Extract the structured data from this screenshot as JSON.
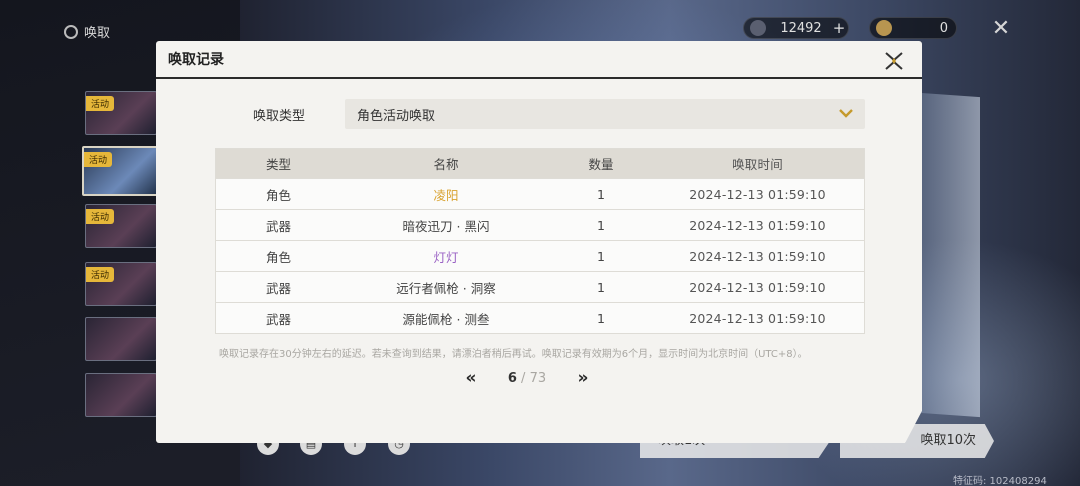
{
  "background": {
    "screen_title": "唤取",
    "banner_tag": "活动",
    "currency_star": "12492",
    "currency_coin": "0",
    "add_symbol": "+",
    "pull_ten_label": "唤取10次",
    "pull_one_label": "唤取1次",
    "uid": "特征码: 102408294"
  },
  "modal": {
    "title": "唤取记录",
    "type_label": "唤取类型",
    "type_value": "角色活动唤取",
    "columns": [
      "类型",
      "名称",
      "数量",
      "唤取时间"
    ],
    "rows": [
      {
        "type": "角色",
        "name": "凌阳",
        "qty": "1",
        "time": "2024-12-13 01:59:10",
        "name_color": "#d9a22e"
      },
      {
        "type": "武器",
        "name": "暗夜迅刀 · 黑闪",
        "qty": "1",
        "time": "2024-12-13 01:59:10",
        "name_color": "#444444"
      },
      {
        "type": "角色",
        "name": "灯灯",
        "qty": "1",
        "time": "2024-12-13 01:59:10",
        "name_color": "#9a62c4"
      },
      {
        "type": "武器",
        "name": "远行者佩枪 · 洞察",
        "qty": "1",
        "time": "2024-12-13 01:59:10",
        "name_color": "#444444"
      },
      {
        "type": "武器",
        "name": "源能佩枪 · 测叁",
        "qty": "1",
        "time": "2024-12-13 01:59:10",
        "name_color": "#444444"
      }
    ],
    "note": "唤取记录存在30分钟左右的延迟。若未查询到结果，请漂泊者稍后再试。唤取记录有效期为6个月，显示时间为北京时间（UTC+8）。",
    "pager": {
      "current": "6",
      "separator": "/",
      "total": "73",
      "prev_symbol": "«",
      "next_symbol": "»"
    }
  },
  "colors": {
    "accent_gold": "#c59a2c",
    "five_star": "#d9a22e",
    "four_star": "#9a62c4"
  }
}
